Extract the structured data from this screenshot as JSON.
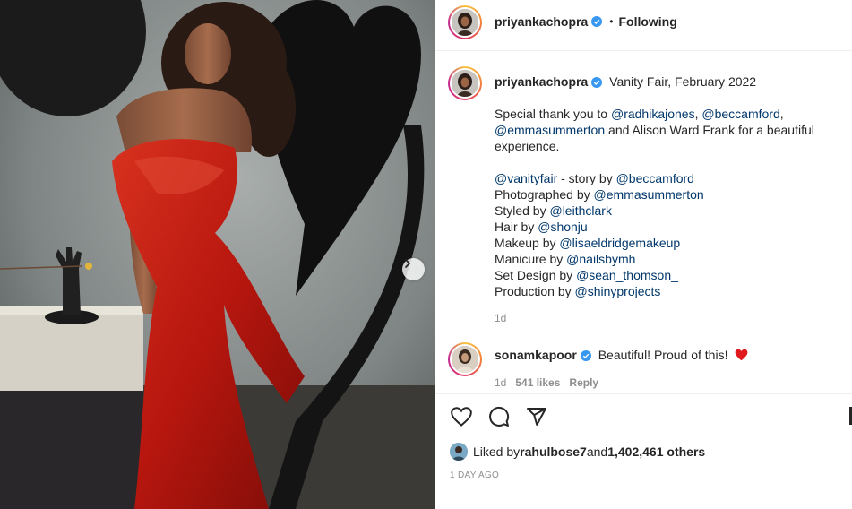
{
  "header": {
    "username": "priyankachopra",
    "separator": "•",
    "follow_status": "Following"
  },
  "caption": {
    "username": "priyankachopra",
    "title": "Vanity Fair, February 2022",
    "thanks_prefix": "Special thank you to ",
    "thanks_mention_1": "@radhikajones",
    "thanks_comma": ", ",
    "thanks_mention_2": "@beccamford",
    "thanks_comma_2": ",",
    "thanks_mention_3": "@emmasummerton",
    "thanks_suffix": " and Alison Ward Frank for a beautiful experience.",
    "credits": [
      {
        "prefix": "",
        "mention": "@vanityfair",
        "mid": " - story by ",
        "mention2": "@beccamford"
      },
      {
        "prefix": "Photographed by ",
        "mention": "@emmasummerton"
      },
      {
        "prefix": "Styled by ",
        "mention": "@leithclark"
      },
      {
        "prefix": "Hair by ",
        "mention": "@shonju"
      },
      {
        "prefix": "Makeup by ",
        "mention": "@lisaeldridgemakeup"
      },
      {
        "prefix": "Manicure by ",
        "mention": "@nailsbymh"
      },
      {
        "prefix": "Set Design by ",
        "mention": "@sean_thomson_"
      },
      {
        "prefix": "Production by ",
        "mention": "@shinyprojects"
      }
    ],
    "time": "1d"
  },
  "comment": {
    "username": "sonamkapoor",
    "text": "Beautiful! Proud of this!",
    "time": "1d",
    "likes": "541 likes",
    "reply": "Reply"
  },
  "likes": {
    "prefix": "Liked by ",
    "user": "rahulbose7",
    "and": " and ",
    "count": "1,402,461 others"
  },
  "post_age": "1 DAY AGO",
  "icons": {
    "like": "heart-icon",
    "comment": "comment-icon",
    "share": "share-icon",
    "next": "chevron-right-icon",
    "verified": "verified-badge-icon",
    "comment_heart": "red-heart-emoji"
  },
  "colors": {
    "link": "#00376b",
    "verified": "#3897f0",
    "muted": "#8e8e8e",
    "dress": "#c8241a"
  }
}
